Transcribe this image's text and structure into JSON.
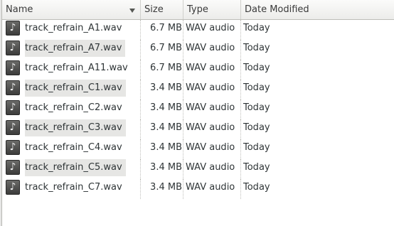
{
  "columns": {
    "name": "Name",
    "size": "Size",
    "type": "Type",
    "date_modified": "Date Modified"
  },
  "icons": {
    "sort": "chevron-down-icon",
    "file": "audio-file-icon"
  },
  "files": [
    {
      "name": "track_refrain_A1.wav",
      "size": "6.7 MB",
      "type": "WAV audio",
      "date": "Today",
      "shaded": false
    },
    {
      "name": "track_refrain_A7.wav",
      "size": "6.7 MB",
      "type": "WAV audio",
      "date": "Today",
      "shaded": true
    },
    {
      "name": "track_refrain_A11.wav",
      "size": "6.7 MB",
      "type": "WAV audio",
      "date": "Today",
      "shaded": false
    },
    {
      "name": "track_refrain_C1.wav",
      "size": "3.4 MB",
      "type": "WAV audio",
      "date": "Today",
      "shaded": true
    },
    {
      "name": "track_refrain_C2.wav",
      "size": "3.4 MB",
      "type": "WAV audio",
      "date": "Today",
      "shaded": false
    },
    {
      "name": "track_refrain_C3.wav",
      "size": "3.4 MB",
      "type": "WAV audio",
      "date": "Today",
      "shaded": true
    },
    {
      "name": "track_refrain_C4.wav",
      "size": "3.4 MB",
      "type": "WAV audio",
      "date": "Today",
      "shaded": false
    },
    {
      "name": "track_refrain_C5.wav",
      "size": "3.4 MB",
      "type": "WAV audio",
      "date": "Today",
      "shaded": true
    },
    {
      "name": "track_refrain_C7.wav",
      "size": "3.4 MB",
      "type": "WAV audio",
      "date": "Today",
      "shaded": false
    }
  ]
}
